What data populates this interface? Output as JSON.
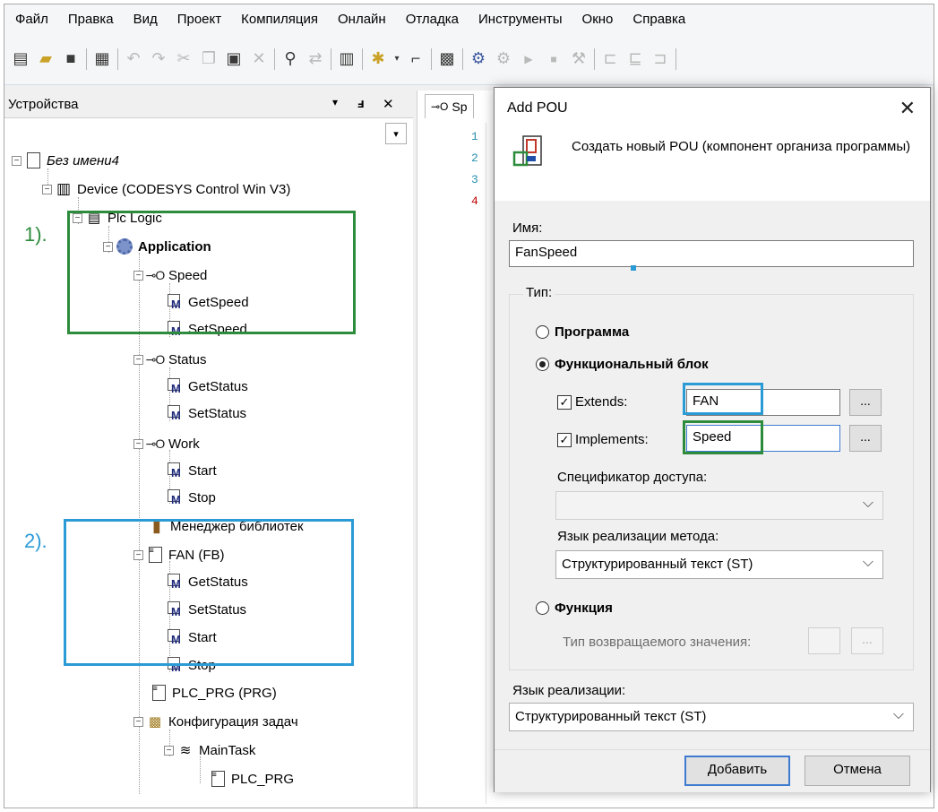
{
  "menu": [
    "Файл",
    "Правка",
    "Вид",
    "Проект",
    "Компиляция",
    "Онлайн",
    "Отладка",
    "Инструменты",
    "Окно",
    "Справка"
  ],
  "devices_panel": {
    "title": "Устройства",
    "pin_glyph": "ᵩ",
    "close_glyph": "✕",
    "dropdown_glyph": "▾"
  },
  "tree": {
    "project": "Без имени4",
    "device": "Device (CODESYS Control Win V3)",
    "plc_logic": "Plc Logic",
    "application": "Application",
    "speed": "Speed",
    "get_speed": "GetSpeed",
    "set_speed": "SetSpeed",
    "status": "Status",
    "get_status": "GetStatus",
    "set_status": "SetStatus",
    "work": "Work",
    "start": "Start",
    "stop": "Stop",
    "library_manager": "Менеджер библиотек",
    "fan": "FAN (FB)",
    "fan_get_status": "GetStatus",
    "fan_set_status": "SetStatus",
    "fan_start": "Start",
    "fan_stop": "Stop",
    "plc_prg": "PLC_PRG (PRG)",
    "task_config": "Конфигурация задач",
    "main_task": "MainTask",
    "main_task_prg": "PLC_PRG"
  },
  "annotations": {
    "first": "1).",
    "second": "2)."
  },
  "editor": {
    "tab_label": "Sp",
    "line_numbers": [
      "1",
      "2",
      "3",
      "4"
    ]
  },
  "dialog": {
    "title": "Add POU",
    "description": "Создать новый POU (компонент организа программы)",
    "name_label": "Имя:",
    "name_value": "FanSpeed",
    "type_label": "Тип:",
    "radio_program": "Программа",
    "radio_fb": "Функциональный блок",
    "extends_label": "Extends:",
    "extends_value": "FAN",
    "implements_label": "Implements:",
    "implements_value": "Speed",
    "ellipsis": "...",
    "access_label": "Спецификатор доступа:",
    "access_value": "",
    "method_lang_label": "Язык реализации метода:",
    "method_lang_value": "Структурированный текст (ST)",
    "radio_function": "Функция",
    "return_type_label": "Тип возвращаемого значения:",
    "impl_lang_label": "Язык реализации:",
    "impl_lang_value": "Структурированный текст (ST)",
    "add_button": "Добавить",
    "cancel_button": "Отмена"
  },
  "colors": {
    "highlight_green": "#2d8c3c",
    "highlight_blue": "#2b9bd6"
  }
}
